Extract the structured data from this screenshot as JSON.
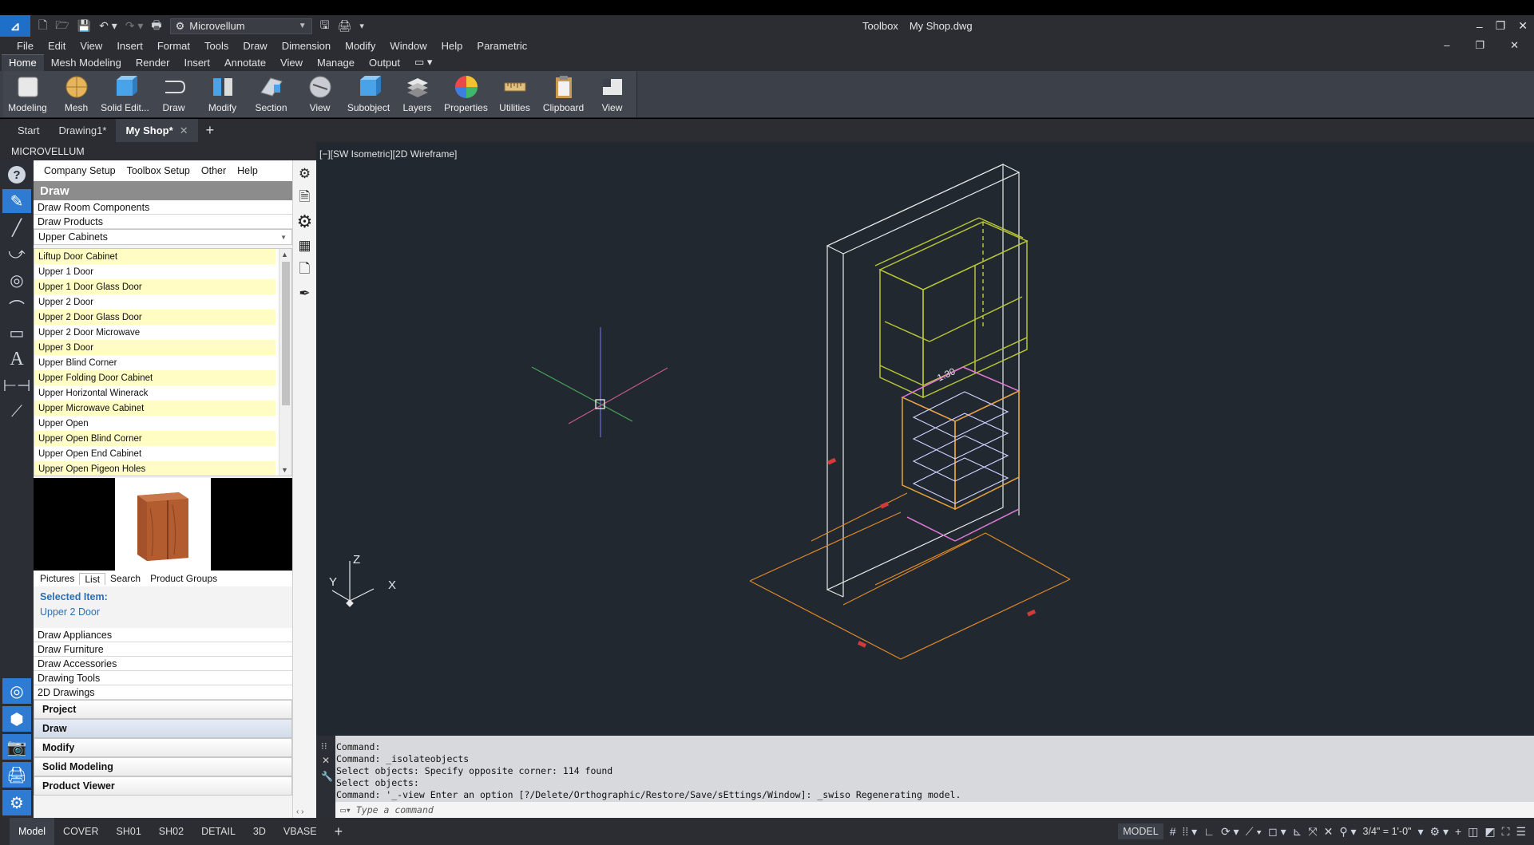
{
  "title_bar": {
    "workspace": "Microvellum",
    "app_name": "Toolbox",
    "document": "My Shop.dwg"
  },
  "menu": [
    "File",
    "Edit",
    "View",
    "Insert",
    "Format",
    "Tools",
    "Draw",
    "Dimension",
    "Modify",
    "Window",
    "Help",
    "Parametric"
  ],
  "ribbon_tabs": [
    "Home",
    "Mesh Modeling",
    "Render",
    "Insert",
    "Annotate",
    "View",
    "Manage",
    "Output"
  ],
  "ribbon_buttons": [
    "Modeling",
    "Mesh",
    "Solid Edit...",
    "Draw",
    "Modify",
    "Section",
    "View",
    "Subobject",
    "Layers",
    "Properties",
    "Utilities",
    "Clipboard",
    "View"
  ],
  "doc_tabs": {
    "start": "Start",
    "drawing1": "Drawing1*",
    "myshop": "My Shop*"
  },
  "palette": {
    "title": "MICROVELLUM",
    "menu": [
      "Company Setup",
      "Toolbox Setup",
      "Other",
      "Help"
    ],
    "header": "Draw",
    "links": [
      "Draw Room Components",
      "Draw Products"
    ],
    "category_select": "Upper Cabinets",
    "products": [
      "Liftup Door Cabinet",
      "Upper 1 Door",
      "Upper 1 Door Glass Door",
      "Upper 2 Door",
      "Upper 2 Door Glass Door",
      "Upper 2 Door Microwave",
      "Upper 3 Door",
      "Upper Blind Corner",
      "Upper Folding Door Cabinet",
      "Upper Horizontal Winerack",
      "Upper Microwave Cabinet",
      "Upper Open",
      "Upper Open Blind Corner",
      "Upper Open End Cabinet",
      "Upper Open Pigeon Holes"
    ],
    "view_tabs": [
      "Pictures",
      "List",
      "Search",
      "Product Groups"
    ],
    "selected_item_label": "Selected Item:",
    "selected_item_value": "Upper 2 Door",
    "categories": [
      "Draw Appliances",
      "Draw Furniture",
      "Draw Accessories",
      "Drawing Tools",
      "2D Drawings"
    ],
    "sections": [
      "Project",
      "Draw",
      "Modify",
      "Solid Modeling",
      "Product Viewer"
    ]
  },
  "viewport": {
    "label": "[−][SW Isometric][2D Wireframe]",
    "dimension_text": "1.30",
    "axis_labels": {
      "x": "X",
      "y": "Y",
      "z": "Z"
    }
  },
  "command": {
    "history": [
      "Command:",
      "Command: _isolateobjects",
      "Select objects: Specify opposite corner: 114 found",
      "Select objects:",
      "Command: '_-view Enter an option [?/Delete/Orthographic/Restore/Save/sEttings/Window]: _swiso Regenerating model."
    ],
    "placeholder": "Type a command"
  },
  "status": {
    "layouts": [
      "Model",
      "COVER",
      "SH01",
      "SH02",
      "DETAIL",
      "3D",
      "VBASE"
    ],
    "mode": "MODEL",
    "scale": "3/4\" = 1'-0\""
  },
  "colors": {
    "accent": "#2e7bd3",
    "viewport_bg": "#212830",
    "list_highlight": "#fffcc4"
  }
}
